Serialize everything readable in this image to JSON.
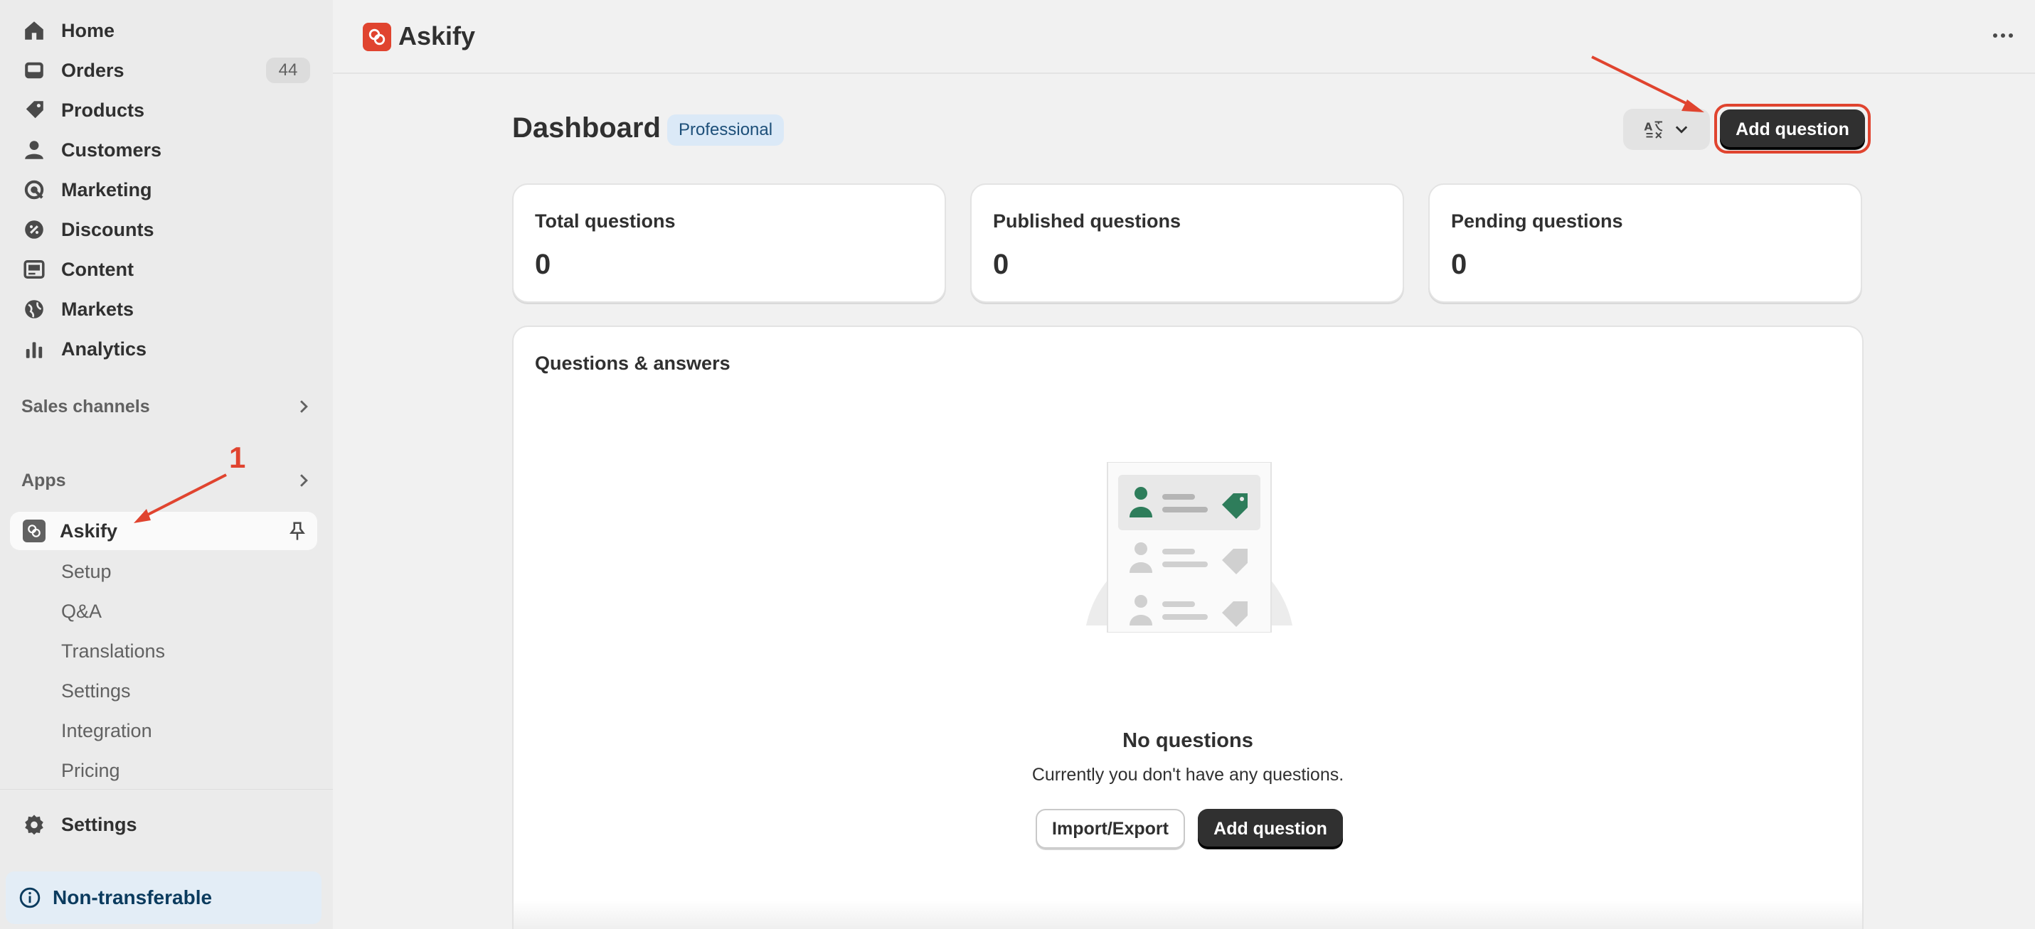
{
  "sidebar": {
    "items": [
      {
        "label": "Home",
        "icon": "home-icon"
      },
      {
        "label": "Orders",
        "icon": "inbox-icon",
        "badge": "44"
      },
      {
        "label": "Products",
        "icon": "tag-icon"
      },
      {
        "label": "Customers",
        "icon": "person-icon"
      },
      {
        "label": "Marketing",
        "icon": "target-icon"
      },
      {
        "label": "Discounts",
        "icon": "discount-icon"
      },
      {
        "label": "Content",
        "icon": "content-icon"
      },
      {
        "label": "Markets",
        "icon": "globe-icon"
      },
      {
        "label": "Analytics",
        "icon": "bar-chart-icon"
      }
    ],
    "sales_channels": "Sales channels",
    "apps": "Apps",
    "app": {
      "label": "Askify"
    },
    "sub_items": [
      "Setup",
      "Q&A",
      "Translations",
      "Settings",
      "Integration",
      "Pricing"
    ],
    "settings": "Settings",
    "non_transferable": "Non-transferable"
  },
  "topbar": {
    "app_title": "Askify"
  },
  "main": {
    "title": "Dashboard",
    "plan_badge": "Professional",
    "add_question": "Add question",
    "stats": [
      {
        "label": "Total questions",
        "value": "0"
      },
      {
        "label": "Published questions",
        "value": "0"
      },
      {
        "label": "Pending questions",
        "value": "0"
      }
    ],
    "qa": {
      "title": "Questions & answers",
      "empty_title": "No questions",
      "empty_sub": "Currently you don't have any questions.",
      "import_export": "Import/Export",
      "add_question": "Add question"
    }
  },
  "annotations": {
    "step_number": "1"
  },
  "colors": {
    "accent_red": "#e0442f",
    "primary_button": "#303030",
    "badge_blue": "#dbe9f7",
    "illustration_green": "#2e7d5b"
  }
}
